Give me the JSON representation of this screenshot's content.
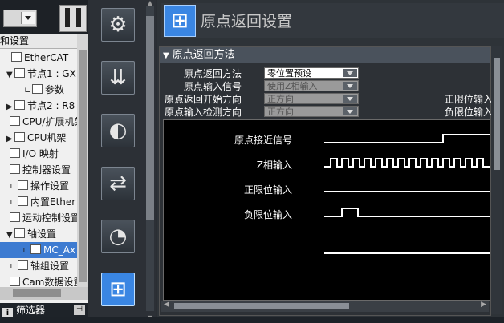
{
  "tree": {
    "header": "和设置",
    "items": [
      {
        "label": "EtherCAT",
        "indent": 4,
        "twisty": ""
      },
      {
        "label": "节点1 : GX",
        "indent": 8,
        "twisty": "▼"
      },
      {
        "label": "参数",
        "indent": 30,
        "twisty": "∟"
      },
      {
        "label": "节点2 : R8",
        "indent": 8,
        "twisty": "▶"
      },
      {
        "label": "CPU/扩展机架",
        "indent": 2,
        "twisty": ""
      },
      {
        "label": "CPU机架",
        "indent": 8,
        "twisty": "▶"
      },
      {
        "label": "I/O 映射",
        "indent": 2,
        "twisty": ""
      },
      {
        "label": "控制器设置",
        "indent": 2,
        "twisty": ""
      },
      {
        "label": "操作设置",
        "indent": 12,
        "twisty": "∟"
      },
      {
        "label": "内置Ether",
        "indent": 12,
        "twisty": "∟"
      },
      {
        "label": "运动控制设置",
        "indent": 2,
        "twisty": ""
      },
      {
        "label": "轴设置",
        "indent": 8,
        "twisty": "▼"
      },
      {
        "label": "MC_Ax",
        "indent": 28,
        "twisty": "∟",
        "selected": true
      },
      {
        "label": "轴组设置",
        "indent": 12,
        "twisty": "∟"
      },
      {
        "label": "Cam数据设置",
        "indent": 2,
        "twisty": ""
      }
    ],
    "filter_label": "筛选器"
  },
  "toolbar": {
    "icons": [
      "gear-search-icon",
      "io-settings-icon",
      "servo-motor-icon",
      "transfer-arrows-icon",
      "gauge-icon",
      "homing-icon"
    ]
  },
  "title": "原点返回设置",
  "section": {
    "title": "原点返回方法",
    "rows": [
      {
        "label": "原点返回方法",
        "value": "零位置预设",
        "enabled": true
      },
      {
        "label": "原点输入信号",
        "value": "使用Z相输入",
        "enabled": false
      },
      {
        "label": "原点返回开始方向",
        "value": "正方向",
        "enabled": false
      },
      {
        "label": "原点输入检测方向",
        "value": "正方向",
        "enabled": false
      }
    ],
    "right_labels": [
      "正限位输入",
      "负限位输入"
    ]
  },
  "timing": {
    "signals": [
      "原点接近信号",
      "Z相输入",
      "正限位输入",
      "负限位输入"
    ]
  },
  "colors": {
    "accent": "#3a86e3",
    "selected": "#3d7bd1"
  }
}
